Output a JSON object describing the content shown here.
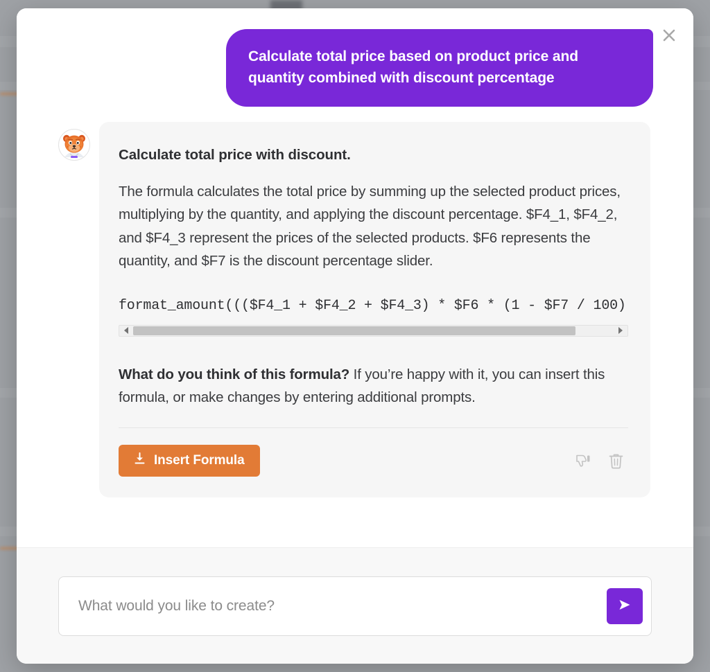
{
  "modal": {
    "close_label": "✕"
  },
  "conversation": {
    "user_message": "Calculate total price based on product price and quantity combined with discount percentage",
    "avatar_name": "bear-mascot-avatar",
    "assistant": {
      "title": "Calculate total price with discount.",
      "body": "The formula calculates the total price by summing up the selected product prices, multiplying by the quantity, and applying the discount percentage. $F4_1, $F4_2, and $F4_3 represent the prices of the selected products. $F6 represents the quantity, and $F7 is the discount percentage slider.",
      "code": "format_amount((($F4_1 + $F4_2 + $F4_3) * $F6 * (1 - $F7 / 100)",
      "followup_bold": "What do you think of this formula?",
      "followup_rest": " If you’re happy with it, you can insert this formula, or make changes by entering additional prompts.",
      "insert_button_label": "Insert Formula",
      "insert_button_icon": "download-icon",
      "thumbs_down_icon": "thumbs-down-icon",
      "delete_icon": "trash-icon",
      "scrollbar": {
        "left_arrow_icon": "caret-left-icon",
        "right_arrow_icon": "caret-right-icon",
        "thumb_fraction": "0.92"
      }
    }
  },
  "composer": {
    "placeholder": "What would you like to create?",
    "value": "",
    "send_icon": "send-arrow-icon"
  },
  "colors": {
    "user_bubble": "#7928d8",
    "accent_purple": "#7928d8",
    "insert_orange": "#e27b36",
    "card_bg": "#f6f6f6",
    "footer_bg": "#f8f8f8",
    "backdrop": "#9a9da2"
  }
}
